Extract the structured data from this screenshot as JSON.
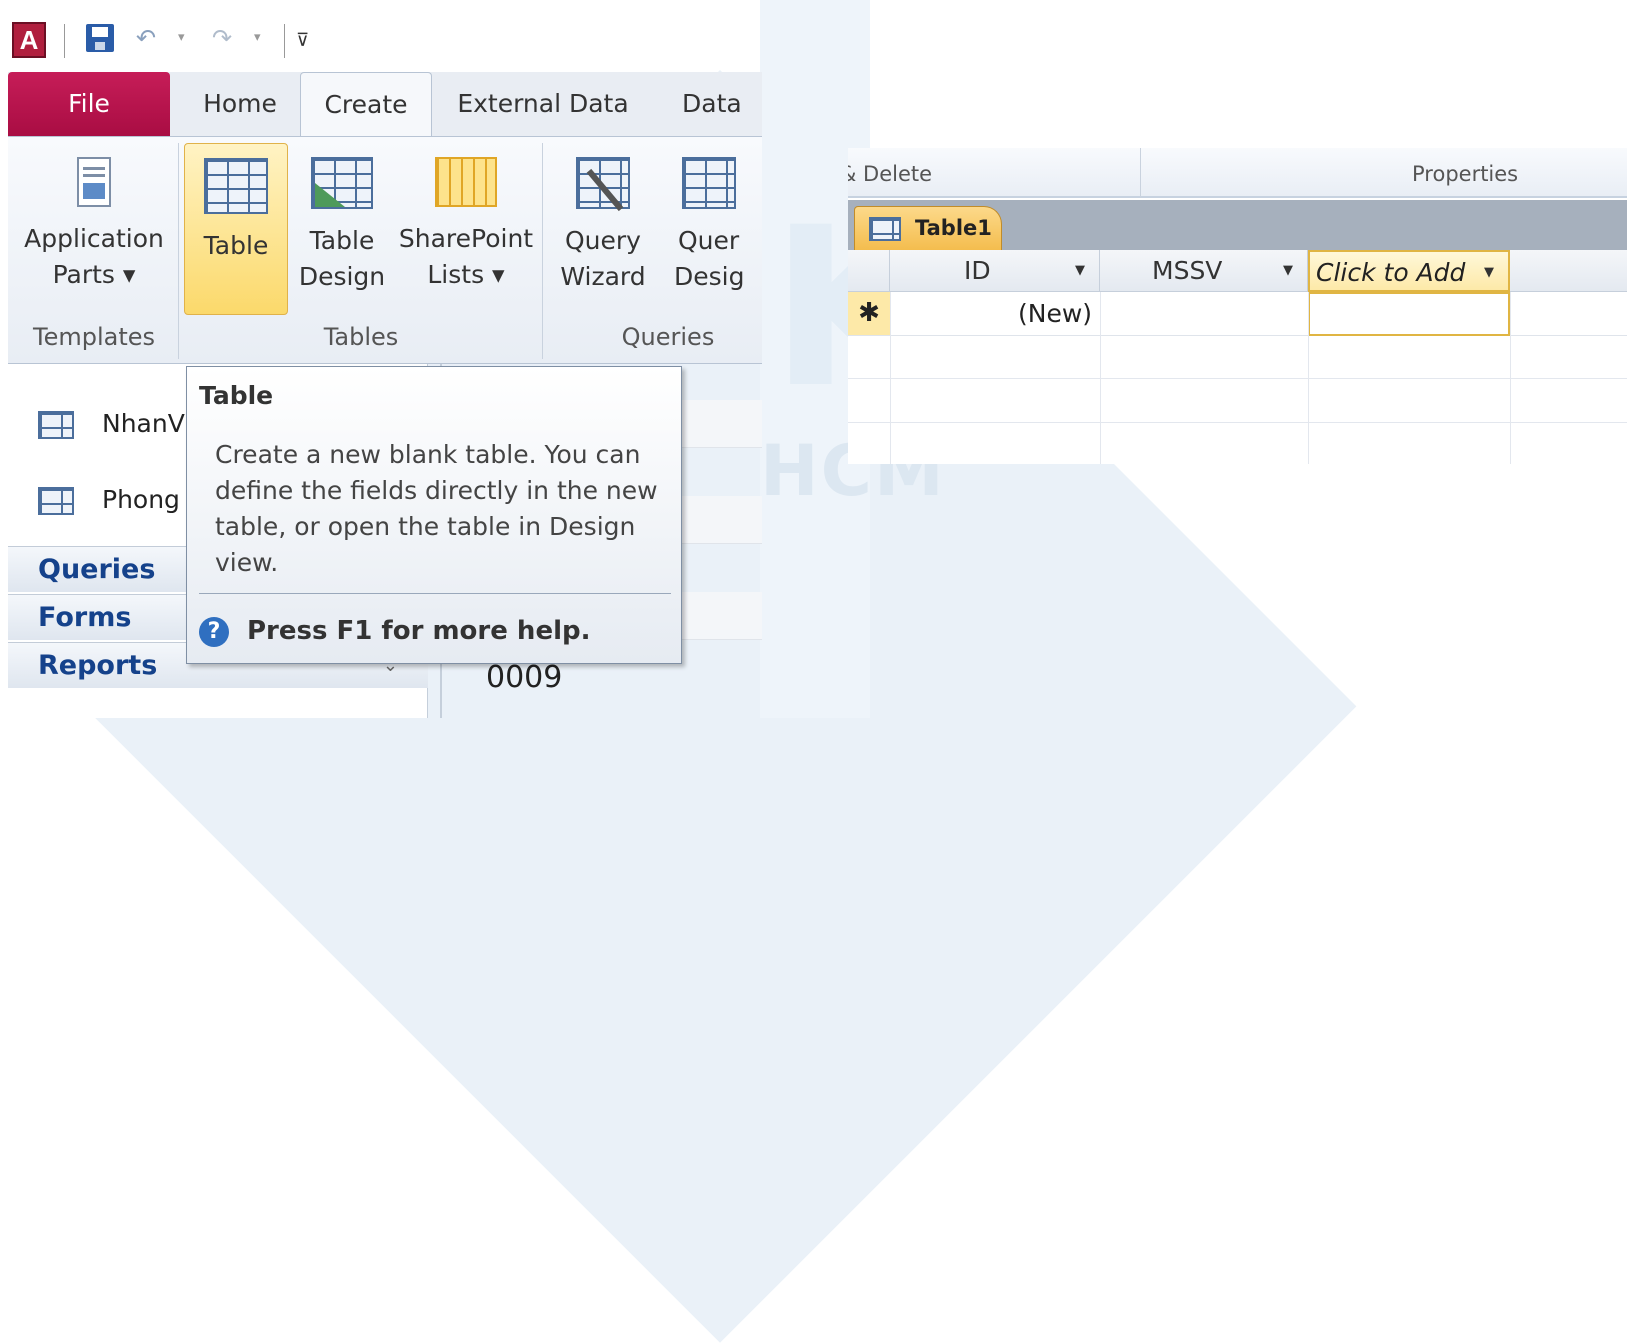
{
  "qat": {
    "app_letter": "A"
  },
  "tabs": [
    {
      "label": "File"
    },
    {
      "label": "Home"
    },
    {
      "label": "Create"
    },
    {
      "label": "External Data"
    },
    {
      "label": "Data"
    }
  ],
  "ribbon": {
    "application_parts": {
      "line1": "Application",
      "line2": "Parts ▾"
    },
    "table": {
      "label": "Table"
    },
    "table_design": {
      "line1": "Table",
      "line2": "Design"
    },
    "sharepoint_lists": {
      "line1": "SharePoint",
      "line2": "Lists ▾"
    },
    "query_wizard": {
      "line1": "Query",
      "line2": "Wizard"
    },
    "query_design": {
      "line1": "Quer",
      "line2": "Desig"
    },
    "groups": {
      "templates": "Templates",
      "tables": "Tables",
      "queries": "Queries"
    }
  },
  "nav": {
    "items": [
      {
        "label": "NhanV"
      },
      {
        "label": "Phong"
      }
    ],
    "groups": [
      {
        "label": "Queries"
      },
      {
        "label": "Forms"
      },
      {
        "label": "Reports"
      }
    ],
    "record_value": "0009"
  },
  "tooltip": {
    "title": "Table",
    "body": "Create a new blank table. You can define the fields directly in the new table, or open the table in Design view.",
    "help": "Press F1 for more help."
  },
  "table_window": {
    "groups": {
      "left": "& Delete",
      "right": "Properties"
    },
    "tab_label": "Table1",
    "columns": [
      {
        "label": "ID"
      },
      {
        "label": "MSSV"
      },
      {
        "label": "Click to Add"
      }
    ],
    "new_row": {
      "selector": "✱",
      "id": "(New)"
    }
  },
  "colors": {
    "file_tab": "#b7124d",
    "selected": "#fbd96b",
    "nav_group_text": "#15428b"
  }
}
